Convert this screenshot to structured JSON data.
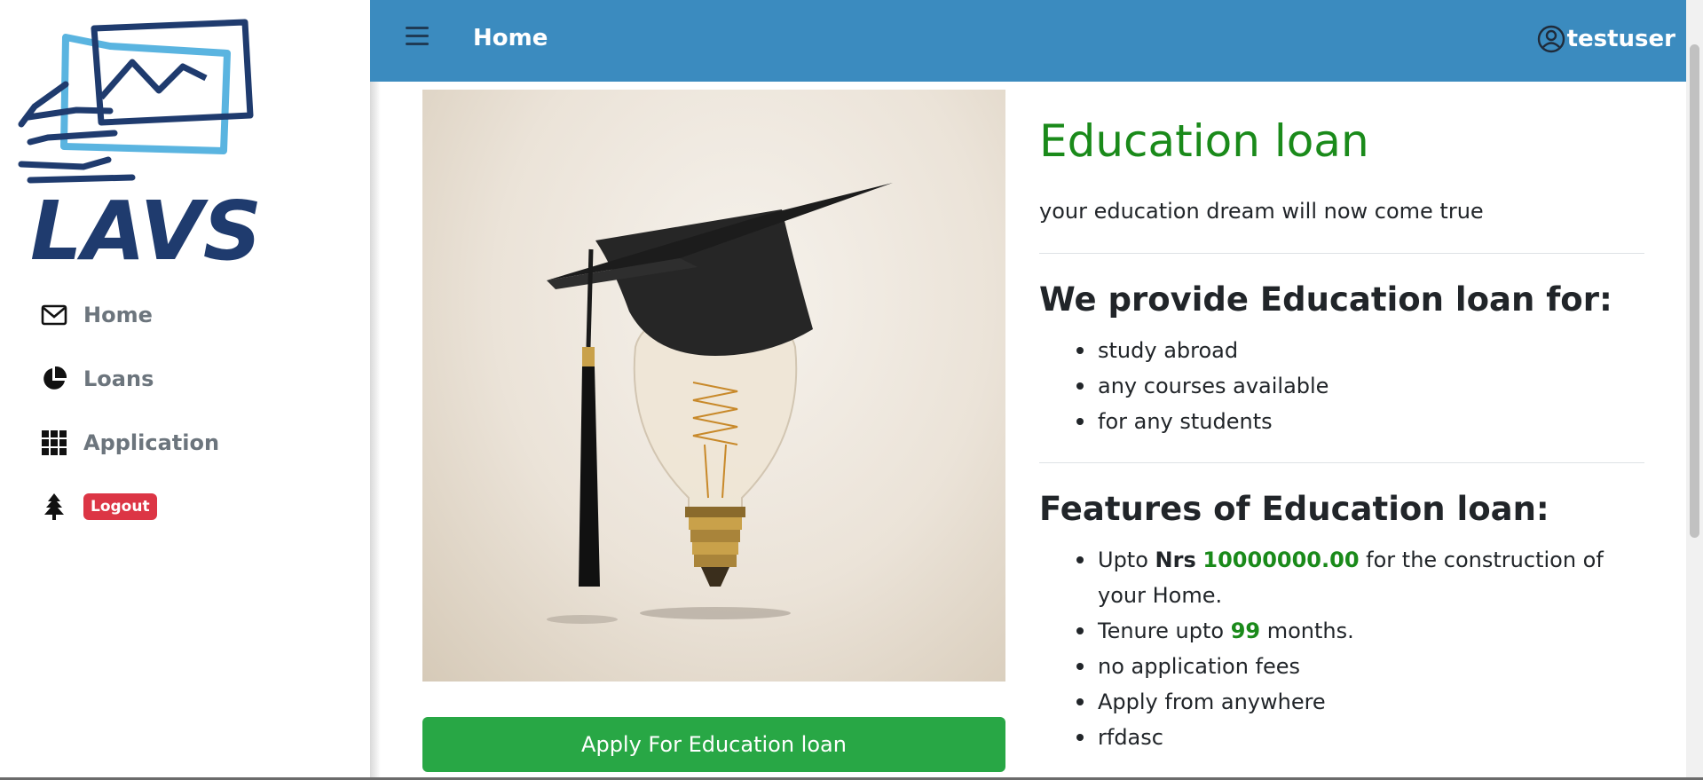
{
  "brand": {
    "logo_text": "LAVS"
  },
  "sidebar": {
    "items": [
      {
        "label": "Home",
        "icon": "envelope-icon"
      },
      {
        "label": "Loans",
        "icon": "pie-chart-icon"
      },
      {
        "label": "Application",
        "icon": "grid-icon"
      },
      {
        "label": "Logout",
        "icon": "tree-icon"
      }
    ]
  },
  "topbar": {
    "title": "Home",
    "username": "testuser"
  },
  "main": {
    "image_alt": "graduation cap on light bulb",
    "apply_button": "Apply For Education loan"
  },
  "info": {
    "title": "Education loan",
    "subtitle": "your education dream will now come true",
    "provide_heading": "We provide Education loan for:",
    "provide_items": [
      "study abroad",
      "any courses available",
      "for any students"
    ],
    "features_heading": "Features of Education loan:",
    "feature_amount": {
      "prefix": "Upto",
      "currency": "Nrs",
      "amount": "10000000.00",
      "suffix": "for the construction of your Home."
    },
    "feature_tenure": {
      "prefix": "Tenure upto",
      "value": "99",
      "suffix": "months."
    },
    "feature_items": [
      "no application fees",
      "Apply from anywhere",
      "rfdasc"
    ]
  },
  "colors": {
    "topbar": "#3b8bbf",
    "accent_green": "#1a8a1a",
    "button_green": "#28a745",
    "logout_red": "#dc3545",
    "logo_navy": "#1f3b6e",
    "logo_light_blue": "#5ab4e0"
  }
}
